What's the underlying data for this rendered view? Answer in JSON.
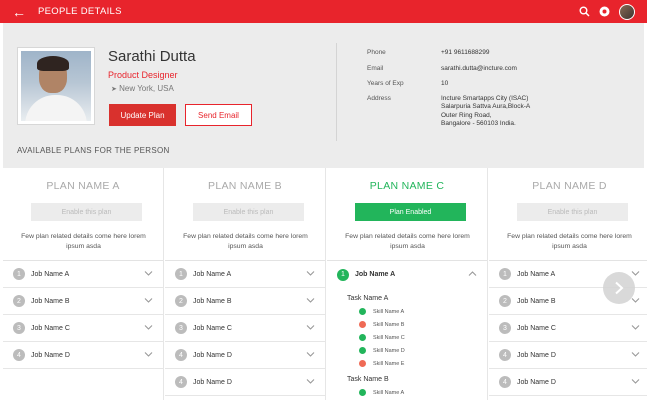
{
  "topbar": {
    "title": "PEOPLE DETAILS",
    "back_icon": "arrow-left-icon"
  },
  "profile": {
    "name": "Sarathi Dutta",
    "role": "Product Designer",
    "location": "New York, USA",
    "update_button": "Update Plan",
    "email_button": "Send Email",
    "available_heading": "AVAILABLE PLANS FOR THE PERSON",
    "details": [
      {
        "label": "Phone",
        "value": "+91 9611688299"
      },
      {
        "label": "Email",
        "value": "sarathi.dutta@incture.com"
      },
      {
        "label": "Years of Exp",
        "value": "10"
      },
      {
        "label": "Address",
        "lines": [
          "Incture Smartapps City (ISAC)",
          "Salarpuria Sattva Aura,Block-A",
          "Outer Ring Road,",
          "Bangalore - 560103 India."
        ]
      }
    ]
  },
  "plans": [
    {
      "name": "PLAN NAME A",
      "button": "Enable this plan",
      "description": "Few plan related details come here lorem ipsum asda",
      "jobs": [
        {
          "num": "1",
          "label": "Job Name A"
        },
        {
          "num": "2",
          "label": "Job Name B"
        },
        {
          "num": "3",
          "label": "Job Name C"
        },
        {
          "num": "4",
          "label": "Job Name D"
        }
      ]
    },
    {
      "name": "PLAN NAME B",
      "button": "Enable this plan",
      "description": "Few plan related details come here lorem ipsum asda",
      "jobs": [
        {
          "num": "1",
          "label": "Job Name A"
        },
        {
          "num": "2",
          "label": "Job Name B"
        },
        {
          "num": "3",
          "label": "Job Name C"
        },
        {
          "num": "4",
          "label": "Job Name D"
        },
        {
          "num": "4",
          "label": "Job Name D"
        }
      ]
    },
    {
      "name": "PLAN NAME C",
      "button": "Plan Enabled",
      "description": "Few plan related details come here lorem ipsum asda",
      "jobs": [
        {
          "num": "1",
          "label": "Job Name A"
        }
      ],
      "tasks": [
        {
          "title": "Task Name A",
          "skills": [
            {
              "label": "Skill Name A",
              "color": "#22b55b"
            },
            {
              "label": "Skill Name B",
              "color": "#ef6a55"
            },
            {
              "label": "Skill Name C",
              "color": "#22b55b"
            },
            {
              "label": "Skill Name D",
              "color": "#22b55b"
            },
            {
              "label": "Skill Name E",
              "color": "#ef6a55"
            }
          ]
        },
        {
          "title": "Task Name B",
          "skills": [
            {
              "label": "Skill Name A",
              "color": "#22b55b"
            }
          ]
        }
      ]
    },
    {
      "name": "PLAN NAME D",
      "button": "Enable this plan",
      "description": "Few plan related details come here lorem ipsum asda",
      "jobs": [
        {
          "num": "1",
          "label": "Job Name A"
        },
        {
          "num": "2",
          "label": "Job Name B"
        },
        {
          "num": "3",
          "label": "Job Name C"
        },
        {
          "num": "4",
          "label": "Job Name D"
        },
        {
          "num": "4",
          "label": "Job Name D"
        }
      ]
    }
  ],
  "colors": {
    "brand": "#e8242c",
    "success": "#22b55b",
    "warning": "#ef6a55",
    "panel": "#ececec"
  }
}
